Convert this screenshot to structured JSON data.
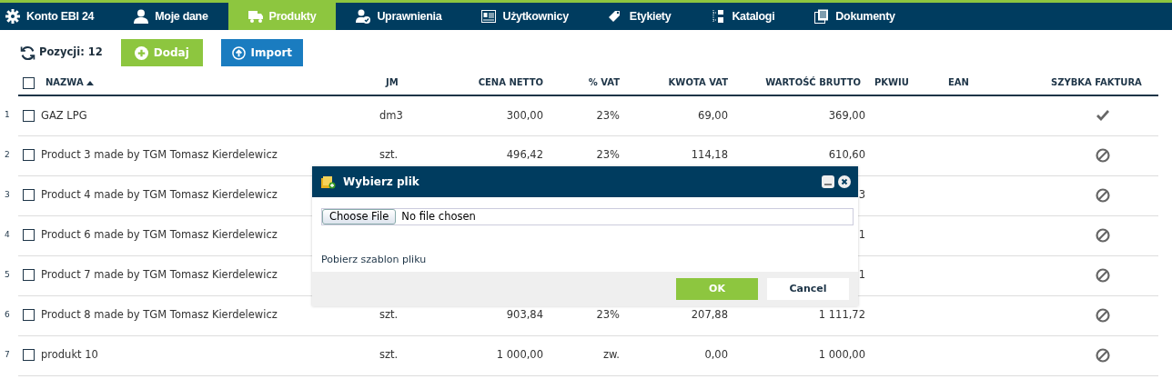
{
  "nav": [
    {
      "label": "Konto EBI 24",
      "selected": false
    },
    {
      "label": "Moje dane",
      "selected": false
    },
    {
      "label": "Produkty",
      "selected": true
    },
    {
      "label": "Uprawnienia",
      "selected": false
    },
    {
      "label": "Użytkownicy",
      "selected": false
    },
    {
      "label": "Etykiety",
      "selected": false
    },
    {
      "label": "Katalogi",
      "selected": false
    },
    {
      "label": "Dokumenty",
      "selected": false
    }
  ],
  "toolbar": {
    "count": "Pozycji: 12",
    "buttons": [
      {
        "label": "Dodaj",
        "kind": "add"
      },
      {
        "label": "Import",
        "kind": "import"
      }
    ]
  },
  "table": {
    "select_all_checked": false,
    "columns": [
      {
        "label": "NAZWA",
        "sorted": true
      },
      {
        "label": "JM"
      },
      {
        "label": "CENA NETTO"
      },
      {
        "label": "% VAT"
      },
      {
        "label": "KWOTA VAT"
      },
      {
        "label": "WARTOŚĆ BRUTTO"
      },
      {
        "label": "PKWIU"
      },
      {
        "label": "EAN"
      },
      {
        "label": "SZYBKA FAKTURA"
      }
    ],
    "rows": [
      {
        "number": "1",
        "checked": false,
        "name": "GAZ LPG",
        "unit": "dm3",
        "net": "300,00",
        "vat": "23%",
        "vat_amount": "69,00",
        "gross": "369,00",
        "quick_invoice": true
      },
      {
        "number": "2",
        "checked": false,
        "name": "Product 3 made by TGM Tomasz Kierdelewicz",
        "unit": "szt.",
        "net": "496,42",
        "vat": "23%",
        "vat_amount": "114,18",
        "gross": "610,60",
        "quick_invoice": false
      },
      {
        "number": "3",
        "checked": false,
        "name": "Product 4 made by TGM Tomasz Kierdelewicz",
        "gross": "3",
        "quick_invoice": false
      },
      {
        "number": "4",
        "checked": false,
        "name": "Product 6 made by TGM Tomasz Kierdelewicz",
        "gross": "1",
        "quick_invoice": false
      },
      {
        "number": "5",
        "checked": false,
        "name": "Product 7 made by TGM Tomasz Kierdelewicz",
        "gross": "1",
        "quick_invoice": false
      },
      {
        "number": "6",
        "checked": false,
        "name": "Product 8 made by TGM Tomasz Kierdelewicz",
        "unit": "szt.",
        "net": "903,84",
        "vat": "23%",
        "vat_amount": "207,88",
        "gross": "1 111,72",
        "quick_invoice": false
      },
      {
        "number": "7",
        "checked": false,
        "name": "produkt 10",
        "unit": "szt.",
        "net": "1 000,00",
        "vat": "zw.",
        "vat_amount": "0,00",
        "gross": "1 000,00",
        "quick_invoice": false
      }
    ]
  },
  "dialog": {
    "title": "Wybierz plik",
    "file_button": "Choose File",
    "file_status": "No file chosen",
    "template_link": "Pobierz szablon pliku",
    "buttons": [
      {
        "label": "OK",
        "kind": "primary"
      },
      {
        "label": "Cancel",
        "kind": "secondary"
      }
    ]
  }
}
